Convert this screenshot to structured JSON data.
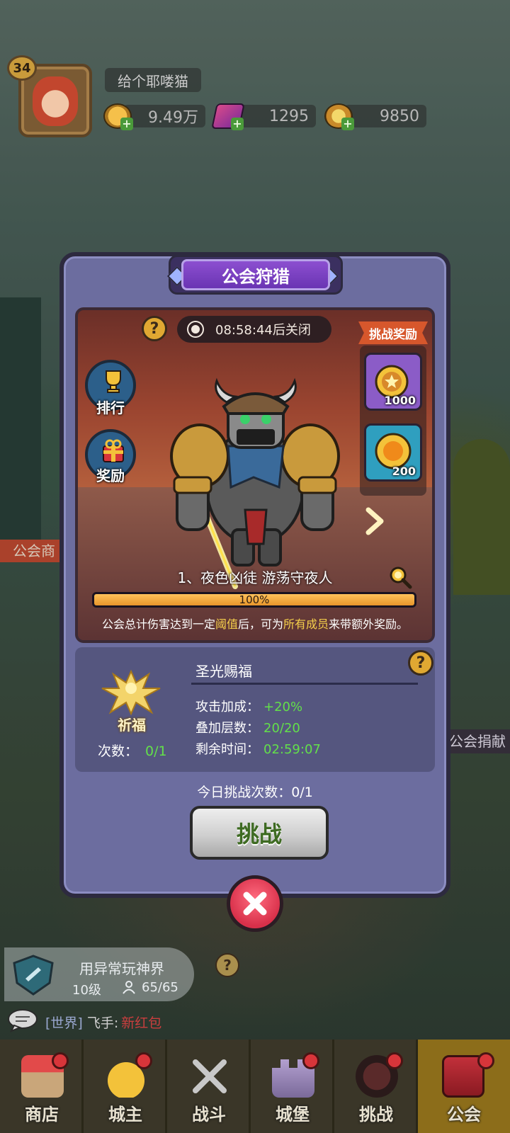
{
  "player": {
    "level": "34",
    "name": "给个耶喽猫",
    "gold": "9.49万",
    "gems": "1295",
    "coins": "9850"
  },
  "modal": {
    "title": "公会狩猎",
    "timer": "08:58:44后关闭",
    "side_buttons": {
      "rank": "排行",
      "reward": "奖励"
    },
    "challenge_reward_header": "挑战奖励",
    "rewards": [
      {
        "icon": "star-medal-icon",
        "count": "1000"
      },
      {
        "icon": "gold-coin-icon",
        "count": "200"
      }
    ],
    "boss_name": "1、夜色凶徒 游荡守夜人",
    "progress_text": "100%",
    "progress": 1.0,
    "description": {
      "part1": "公会总计伤害达到一定",
      "hl1": "阈值",
      "part2": "后，可为",
      "hl2": "所有成员",
      "part3": "来带额外奖励。"
    },
    "blessing": {
      "emblem_label": "祈福",
      "count_label": "次数：",
      "count_value": "0/1",
      "title": "圣光赐福",
      "stats": [
        {
          "label": "攻击加成：",
          "value": "+20%"
        },
        {
          "label": "叠加层数：",
          "value": "20/20"
        },
        {
          "label": "剩余时间：",
          "value": "02:59:07"
        }
      ]
    },
    "today_challenges": "今日挑战次数：0/1",
    "challenge_button": "挑战"
  },
  "background": {
    "left_banner": "公会商",
    "right_banner": "公会捐献"
  },
  "guild": {
    "name": "用异常玩神界",
    "level": "10级",
    "members": "65/65"
  },
  "chat": {
    "channel": "[世界]",
    "sender": "飞手:",
    "message": "新红包"
  },
  "nav": [
    {
      "label": "商店",
      "icon": "shop-icon",
      "dot": true
    },
    {
      "label": "城主",
      "icon": "crown-icon",
      "dot": true
    },
    {
      "label": "战斗",
      "icon": "swords-icon",
      "dot": false
    },
    {
      "label": "城堡",
      "icon": "castle-icon",
      "dot": true
    },
    {
      "label": "挑战",
      "icon": "demon-icon",
      "dot": true
    },
    {
      "label": "公会",
      "icon": "guild-book-icon",
      "dot": true
    }
  ],
  "colors": {
    "modal_bg": "#6c6d9f",
    "title_purple": "#7a40c0",
    "progress": "#f3a93c",
    "highlight": "#f5cf4b",
    "positive": "#63e04a",
    "close_red": "#e0384f"
  }
}
